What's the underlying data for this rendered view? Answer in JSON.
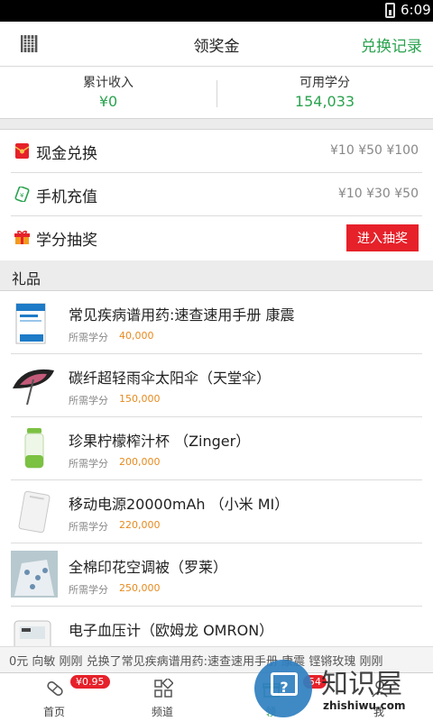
{
  "status_bar": {
    "time": "6:09"
  },
  "header": {
    "title": "领奖金",
    "record_link": "兑换记录"
  },
  "stats": {
    "income_label": "累计收入",
    "income_value": "¥0",
    "credits_label": "可用学分",
    "credits_value": "154,033"
  },
  "menu": {
    "cash": {
      "label": "现金兑换",
      "amounts": "¥10 ¥50 ¥100"
    },
    "phone": {
      "label": "手机充值",
      "amounts": "¥10 ¥30 ¥50"
    },
    "lottery": {
      "label": "学分抽奖",
      "button": "进入抽奖"
    }
  },
  "gifts_header": "礼品",
  "gifts": [
    {
      "name": "常见疾病谱用药:速查速用手册 康震",
      "cost_label": "所需学分",
      "cost": "40,000",
      "icon": "book-thumb"
    },
    {
      "name": "碳纤超轻雨伞太阳伞（天堂伞）",
      "cost_label": "所需学分",
      "cost": "150,000",
      "icon": "umbrella-thumb"
    },
    {
      "name": "珍果柠檬榨汁杯 （Zinger）",
      "cost_label": "所需学分",
      "cost": "200,000",
      "icon": "bottle-thumb"
    },
    {
      "name": "移动电源20000mAh （小米 MI）",
      "cost_label": "所需学分",
      "cost": "220,000",
      "icon": "powerbank-thumb"
    },
    {
      "name": "全棉印花空调被（罗莱）",
      "cost_label": "所需学分",
      "cost": "250,000",
      "icon": "quilt-thumb"
    },
    {
      "name": "电子血压计（欧姆龙 OMRON）",
      "cost_label": "",
      "cost": "",
      "icon": "monitor-thumb"
    }
  ],
  "ticker": "0元  向敏 刚刚 兑换了常见疾病谱用药:速查速用手册 康震  铿锵玫瑰 刚刚",
  "tabs": [
    {
      "label": "首页",
      "badge": "¥0.95",
      "icon": "pill-icon"
    },
    {
      "label": "频道",
      "badge": "",
      "icon": "grid-icon"
    },
    {
      "label": "领",
      "badge": "54",
      "icon": "gift-icon"
    },
    {
      "label": "我",
      "badge": "",
      "icon": "user-icon"
    }
  ],
  "watermark": {
    "text": "知识屋",
    "domain": "zhishiwu.com"
  },
  "colors": {
    "accent_green": "#2aa34f",
    "red": "#e6212a",
    "orange": "#e68a1e"
  }
}
